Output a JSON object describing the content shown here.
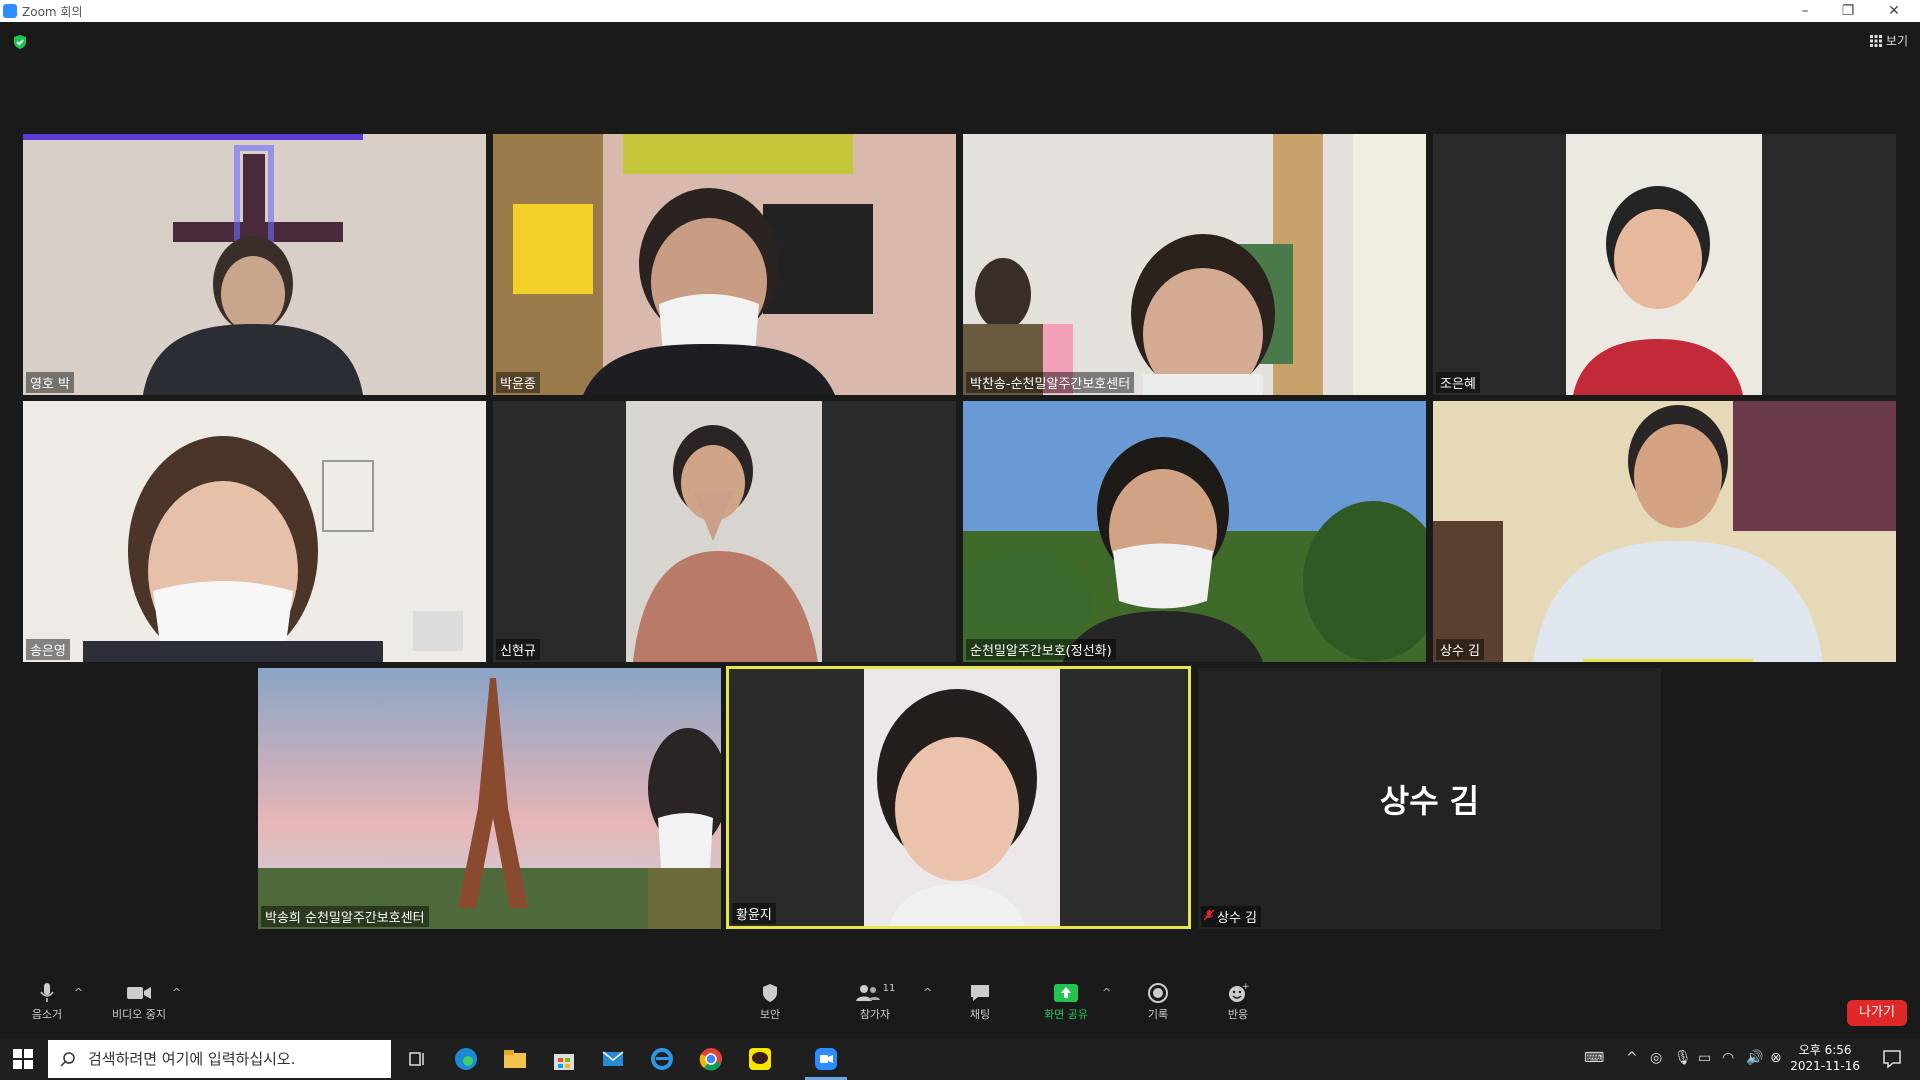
{
  "window": {
    "title": "Zoom 회의",
    "controls": [
      "–",
      "❐",
      "✕"
    ]
  },
  "view_button": {
    "label": "보기",
    "icon": "grid-icon"
  },
  "participants": [
    {
      "name": "영호 박"
    },
    {
      "name": "박윤종"
    },
    {
      "name": "박찬송-순천밀알주간보호센터"
    },
    {
      "name": "조은혜"
    },
    {
      "name": "송은영"
    },
    {
      "name": "신현규"
    },
    {
      "name": "순천밀알주간보호(정선화)"
    },
    {
      "name": "상수 김"
    },
    {
      "name": "박송희 순천밀알주간보호센터"
    },
    {
      "name": "황윤지"
    },
    {
      "name": "상수 김",
      "big_name": "상수 김",
      "muted": true
    }
  ],
  "toolbar": {
    "mute": "음소거",
    "video": "비디오 중지",
    "security": "보안",
    "participants": "참가자",
    "participant_count": "11",
    "chat": "채팅",
    "share": "화면 공유",
    "record": "기록",
    "reactions": "반응",
    "leave": "나가기"
  },
  "colors": {
    "active_speaker": "#e6e64c",
    "share_green": "#23c552",
    "leave_red": "#e02828"
  },
  "taskbar": {
    "search_placeholder": "검색하려면 여기에 입력하십시오.",
    "time": "오후 6:56",
    "date": "2021-11-16"
  }
}
